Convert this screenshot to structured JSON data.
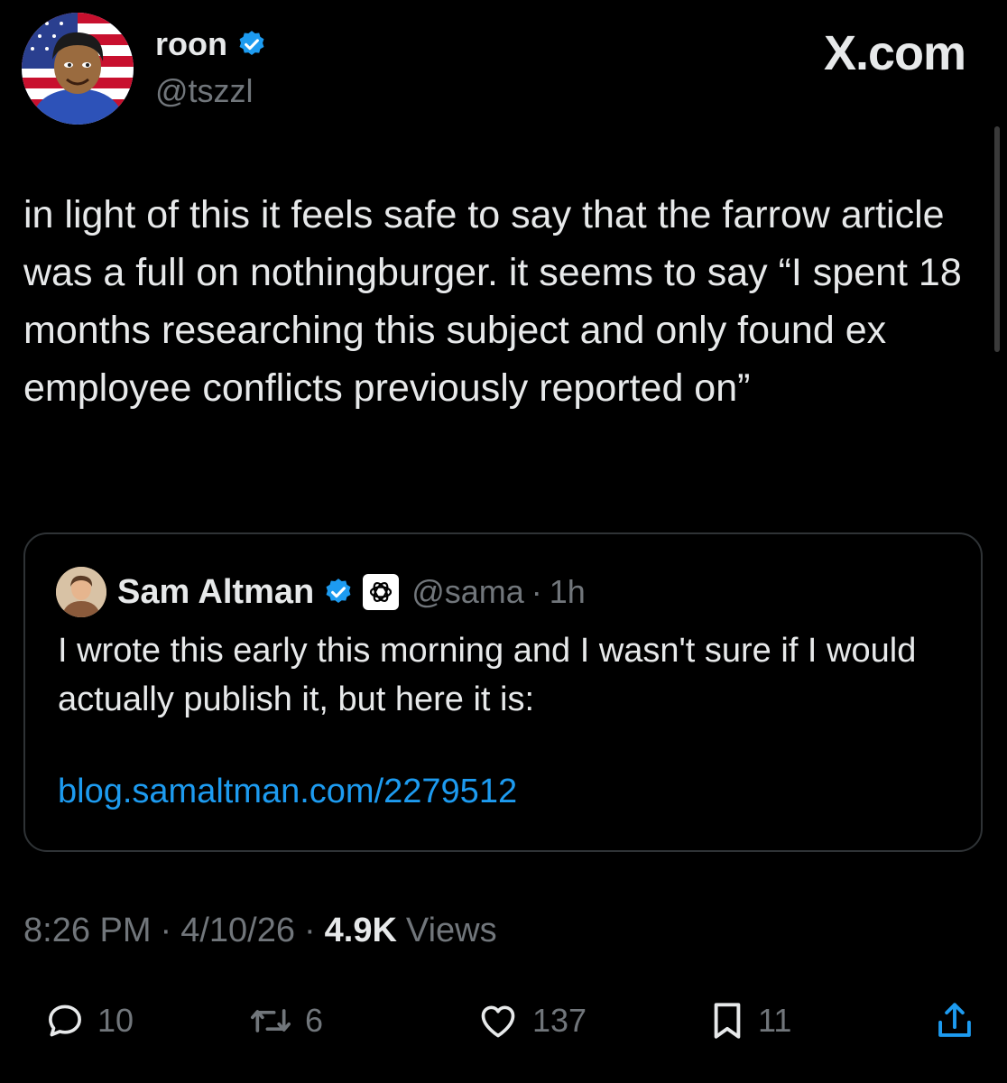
{
  "author": {
    "name": "roon",
    "handle": "@tszzl"
  },
  "watermark": "X.com",
  "tweet": {
    "text": "in light of this it feels safe to say that the farrow article was a full on nothingburger. it seems to say “I spent 18 months researching this subject and only found ex employee conflicts previously reported on”"
  },
  "quote": {
    "name": "Sam Altman",
    "handle": "@sama",
    "separator": "·",
    "time": "1h",
    "text": "I wrote this early this morning and I wasn't sure if I would actually publish it, but here it is:",
    "link": "blog.samaltman.com/2279512"
  },
  "meta": {
    "time": "8:26 PM",
    "separator": "·",
    "date": "4/10/26",
    "views_count": "4.9K",
    "views_label": "Views"
  },
  "actions": {
    "replies": "10",
    "reposts": "6",
    "likes": "137",
    "bookmarks": "11"
  },
  "colors": {
    "background": "#000000",
    "text": "#e7e9ea",
    "muted": "#71767b",
    "link": "#1d9bf0",
    "verified": "#1d9bf0",
    "border": "#2f3336"
  },
  "icons": {
    "reply": "reply-icon",
    "repost": "repost-icon",
    "like": "heart-icon",
    "bookmark": "bookmark-icon",
    "share": "share-icon",
    "verified": "verified-badge-icon",
    "org": "openai-logo-icon"
  }
}
